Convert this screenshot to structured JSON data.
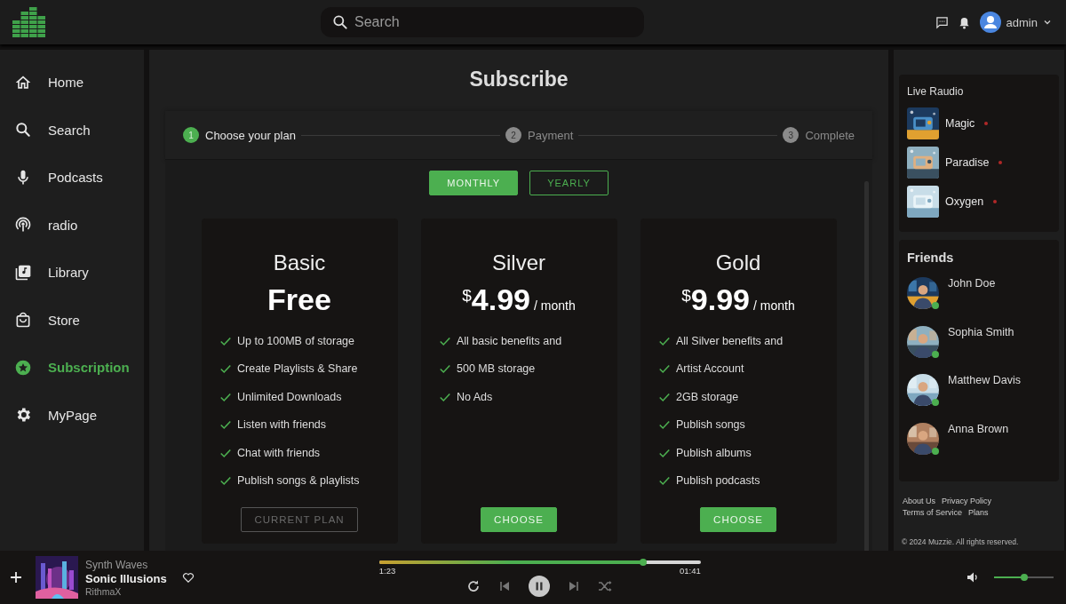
{
  "header": {
    "search": {
      "placeholder": "Search"
    },
    "user": {
      "name": "admin"
    }
  },
  "sidebar": {
    "items": [
      {
        "kind": "home",
        "label": "Home",
        "selected": false
      },
      {
        "kind": "search",
        "label": "Search",
        "selected": false
      },
      {
        "kind": "mic",
        "label": "Podcasts",
        "selected": false
      },
      {
        "kind": "radio",
        "label": "radio",
        "selected": false
      },
      {
        "kind": "library",
        "label": "Library",
        "selected": false
      },
      {
        "kind": "store",
        "label": "Store",
        "selected": false
      },
      {
        "kind": "star",
        "label": "Subscription",
        "selected": true
      },
      {
        "kind": "gear",
        "label": "MyPage",
        "selected": false
      }
    ]
  },
  "subscribe": {
    "title": "Subscribe",
    "steps": [
      {
        "number": "1",
        "label": "Choose your plan",
        "active": true
      },
      {
        "number": "2",
        "label": "Payment",
        "active": false
      },
      {
        "number": "3",
        "label": "Complete",
        "active": false
      }
    ],
    "billing": [
      {
        "label": "MONTHLY",
        "selected": true
      },
      {
        "label": "YEARLY",
        "selected": false
      }
    ],
    "plans": [
      {
        "name": "Basic",
        "price": "Free",
        "features": [
          "Up to 100MB of storage",
          "Create Playlists & Share",
          "Unlimited Downloads",
          "Listen with friends",
          "Chat with friends",
          "Publish songs & playlists"
        ],
        "button": {
          "label": "CURRENT PLAN",
          "kind": "current"
        }
      },
      {
        "name": "Silver",
        "currency": "$",
        "price": "4.99",
        "period": "/ month",
        "features": [
          "All basic benefits and",
          "500 MB storage",
          "No Ads"
        ],
        "button": {
          "label": "CHOOSE",
          "kind": "choose"
        }
      },
      {
        "name": "Gold",
        "currency": "$",
        "price": "9.99",
        "period": "/ month",
        "features": [
          "All Silver benefits and",
          "Artist Account",
          "2GB storage",
          "Publish songs",
          "Publish albums",
          "Publish podcasts"
        ],
        "button": {
          "label": "CHOOSE",
          "kind": "choose"
        }
      }
    ]
  },
  "live_radio": {
    "title": "Live Raudio",
    "stations": [
      {
        "name": "Magic",
        "live": true
      },
      {
        "name": "Paradise",
        "live": true
      },
      {
        "name": "Oxygen",
        "live": true
      }
    ]
  },
  "friends": {
    "title": "Friends",
    "people": [
      {
        "name": "John Doe",
        "online": true
      },
      {
        "name": "Sophia Smith",
        "online": true
      },
      {
        "name": "Matthew Davis",
        "online": true
      },
      {
        "name": "Anna Brown",
        "online": true
      }
    ]
  },
  "footer": {
    "links": [
      "About Us",
      "Privacy Policy",
      "Terms of Service",
      "Plans"
    ],
    "copyright": "© 2024 Muzzie. All rights reserved."
  },
  "player": {
    "playlist": "Synth Waves",
    "title": "Sonic Illusions",
    "artist": "RithmaX",
    "liked": false,
    "elapsed": "1:23",
    "duration": "01:41",
    "level": 0.82,
    "playing": true,
    "volume": {
      "level": 0.5
    }
  }
}
